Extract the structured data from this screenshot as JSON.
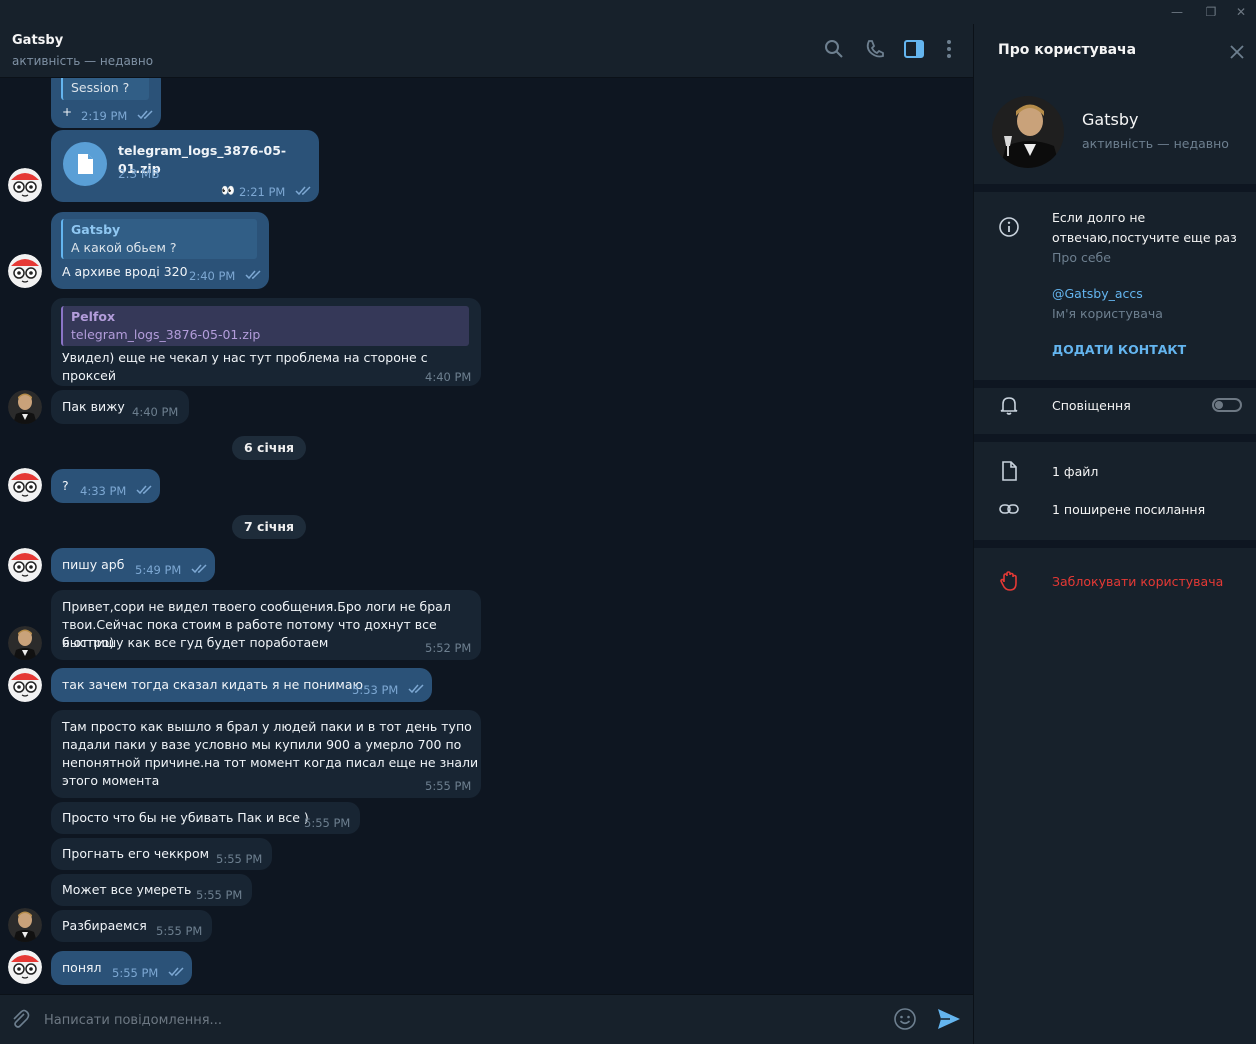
{
  "window": {
    "minimize": "—",
    "restore": "❐",
    "close": "✕"
  },
  "header": {
    "title": "Gatsby",
    "status": "активність — недавно"
  },
  "messages": {
    "m1": {
      "text": "Session ?",
      "prefix": "+",
      "time": "2:19 PM"
    },
    "m2": {
      "file_name": "telegram_logs_3876-05-01.zip",
      "file_size": "2.3 MB",
      "reaction": "👀",
      "time": "2:21 PM"
    },
    "m3": {
      "quote_name": "Gatsby",
      "quote_text": "А какой обьем ?",
      "text": "А архиве вроді 320",
      "time": "2:40 PM"
    },
    "m4": {
      "quote_name": "Pelfox",
      "quote_text": "telegram_logs_3876-05-01.zip",
      "text": "Увидел) еще не чекал у нас тут проблема на стороне с проксей",
      "time": "4:40 PM"
    },
    "m5": {
      "text": "Пак вижу",
      "time": "4:40 PM"
    },
    "date1": "6 січня",
    "m6": {
      "text": "?",
      "time": "4:33 PM"
    },
    "date2": "7 січня",
    "m7": {
      "text": "пишу арб",
      "time": "5:49 PM"
    },
    "m8": {
      "line1": "Привет,сори не видел твоего сообщения.Бро логи не брал",
      "line2": "твои.Сейчас пока стоим в работе потому что дохнут все быстро)",
      "line3": "я отпишу как все гуд будет поработаем",
      "time": "5:52 PM"
    },
    "m9": {
      "text": "так зачем тогда сказал кидать я не понимаю",
      "time": "5:53 PM"
    },
    "m10": {
      "line1": "Там просто как вышло я брал у людей паки и в тот день тупо",
      "line2": "падали паки у вазе условно мы купили 900 а умерло 700 по",
      "line3": "непонятной причине.на  тот момент когда писал еще не знали",
      "line4": "этого момента",
      "time": "5:55 PM"
    },
    "m11": {
      "text": "Просто что бы не убивать Пак и все )",
      "time": "5:55 PM"
    },
    "m12": {
      "text": "Прогнать его чеккром",
      "time": "5:55 PM"
    },
    "m13": {
      "text": "Может все умереть",
      "time": "5:55 PM"
    },
    "m14": {
      "text": "Разбираемся",
      "time": "5:55 PM"
    },
    "m15": {
      "text": "понял",
      "time": "5:55 PM"
    }
  },
  "composer": {
    "placeholder": "Написати повідомлення..."
  },
  "panel": {
    "title": "Про користувача",
    "name": "Gatsby",
    "status": "активність — недавно",
    "bio_line1": "Если долго не",
    "bio_line2": "отвечаю,постучите еще раз",
    "bio_label": "Про себе",
    "username": "@Gatsby_accs",
    "username_label": "Ім'я користувача",
    "add_contact": "ДОДАТИ КОНТАКТ",
    "notifications": "Сповіщення",
    "notifications_on": false,
    "files": "1 файл",
    "links": "1 поширене посилання",
    "block": "Заблокувати користувача"
  },
  "colors": {
    "accent": "#64b5ef",
    "outgoing": "#2b5278",
    "incoming": "#182533",
    "danger": "#e53935"
  }
}
